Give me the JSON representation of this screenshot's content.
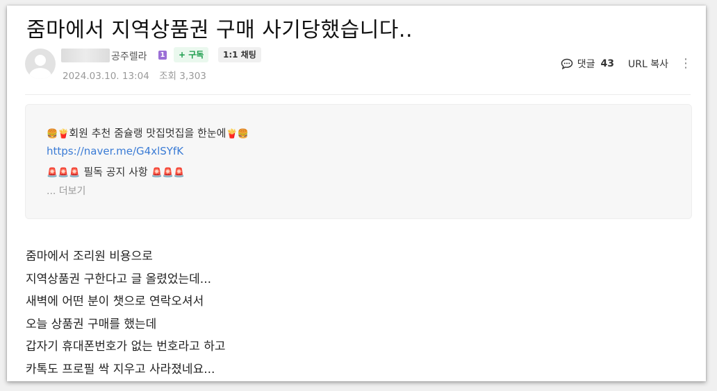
{
  "post": {
    "title": "줌마에서 지역상품권 구매 사기당했습니다..",
    "author": {
      "nickname": "공주렐라",
      "level": "1"
    },
    "subscribe_label": "+ 구독",
    "chat_label": "1:1 채팅",
    "date": "2024.03.10. 13:04",
    "views": "조회 3,303",
    "comment_label": "댓글",
    "comment_count": "43",
    "url_copy_label": "URL 복사",
    "more_icon": "more-vertical-icon"
  },
  "notice": {
    "line1": "회원 추천 줌슐랭 맛집멋집을 한눈에",
    "line1_emojis_left": "🍔🍟",
    "line1_emojis_right": "🍟🍔",
    "link": "https://naver.me/G4xlSYfK",
    "line3": " 필독 공지 사항 ",
    "line3_emojis": "🚨🚨🚨",
    "more": "... 더보기"
  },
  "body": [
    "줌마에서 조리원 비용으로",
    "지역상품권 구한다고 글 올렸었는데...",
    "새벽에 어떤 분이 챗으로 연락오셔서",
    "오늘 상품권 구매를 했는데",
    "갑자기 휴대폰번호가 없는 번호라고 하고",
    "카톡도 프로필 싹 지우고 사라졌네요..."
  ],
  "colors": {
    "subscribe": "#1a9c4b",
    "link": "#3a7bd5",
    "level_badge": "#9b6fd6"
  }
}
